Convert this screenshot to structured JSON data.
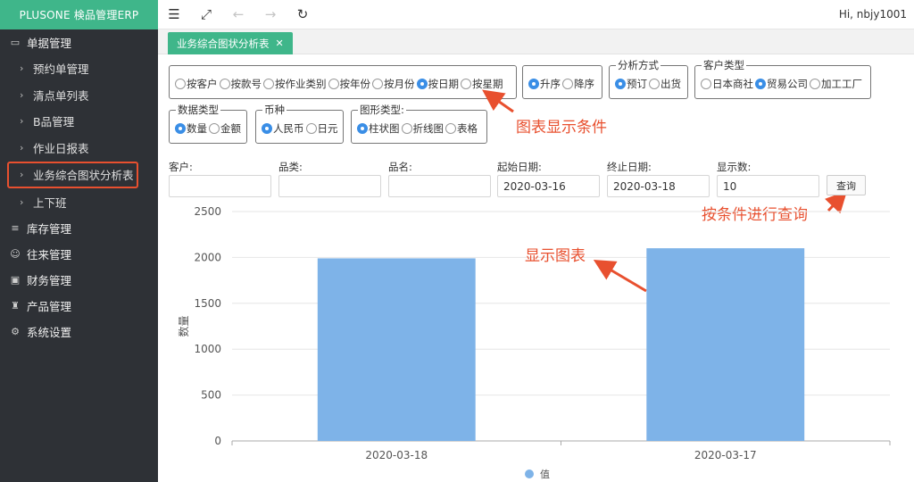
{
  "app": {
    "title": "PLUSONE 検品管理ERP",
    "greeting": "Hi, nbjy1001"
  },
  "sidebar": {
    "groups": [
      {
        "label": "单据管理",
        "icon": "monitor-icon"
      },
      {
        "label": "库存管理",
        "icon": "database-icon"
      },
      {
        "label": "往来管理",
        "icon": "user-icon"
      },
      {
        "label": "财务管理",
        "icon": "wallet-icon"
      },
      {
        "label": "产品管理",
        "icon": "product-icon"
      },
      {
        "label": "系统设置",
        "icon": "gear-icon"
      }
    ],
    "subitems": [
      "预约单管理",
      "清点单列表",
      "B品管理",
      "作业日报表",
      "业务综合图状分析表",
      "上下班"
    ],
    "active": "业务综合图状分析表"
  },
  "toolbar": {
    "icons": [
      "collapse-menu-icon",
      "fullscreen-icon",
      "back-arrow-icon",
      "forward-arrow-icon",
      "refresh-icon"
    ]
  },
  "tab": {
    "label": "业务综合图状分析表",
    "close": "✕"
  },
  "conditions": {
    "group_by": {
      "options": [
        "按客户",
        "按款号",
        "按作业类别",
        "按年份",
        "按月份",
        "按日期",
        "按星期"
      ],
      "selected": "按日期"
    },
    "order": {
      "options": [
        "升序",
        "降序"
      ],
      "selected": "升序"
    },
    "analysis": {
      "legend": "分析方式",
      "options": [
        "预订",
        "出货"
      ],
      "selected": "预订"
    },
    "customer_type": {
      "legend": "客户类型",
      "options": [
        "日本商社",
        "贸易公司",
        "加工工厂"
      ],
      "selected": "贸易公司"
    },
    "data_type": {
      "legend": "数据类型",
      "options": [
        "数量",
        "金额"
      ],
      "selected": "数量"
    },
    "currency": {
      "legend": "币种",
      "options": [
        "人民币",
        "日元"
      ],
      "selected": "人民币"
    },
    "chart_type": {
      "legend": "图形类型:",
      "options": [
        "柱状图",
        "折线图",
        "表格"
      ],
      "selected": "柱状图"
    }
  },
  "filters": {
    "customer_label": "客户:",
    "customer_value": "",
    "category_label": "品类:",
    "category_value": "",
    "product_label": "品名:",
    "product_value": "",
    "start_label": "起始日期:",
    "start_value": "2020-03-16",
    "end_label": "终止日期:",
    "end_value": "2020-03-18",
    "count_label": "显示数:",
    "count_value": "10",
    "query_label": "查询"
  },
  "annotations": {
    "conditions": "图表显示条件",
    "query": "按条件进行查询",
    "chart": "显示图表"
  },
  "colors": {
    "accent": "#3fb68a",
    "bar": "#7eb3e8",
    "annotation": "#e8502f",
    "sidebar": "#2e3136"
  },
  "chart_data": {
    "type": "bar",
    "categories": [
      "2020-03-18",
      "2020-03-17"
    ],
    "series": [
      {
        "name": "值",
        "values": [
          1990,
          2100
        ]
      }
    ],
    "ylabel": "数量",
    "ylim": [
      0,
      2500
    ],
    "yticks": [
      0,
      500,
      1000,
      1500,
      2000,
      2500
    ],
    "grid": true,
    "legend": "bottom-center"
  }
}
